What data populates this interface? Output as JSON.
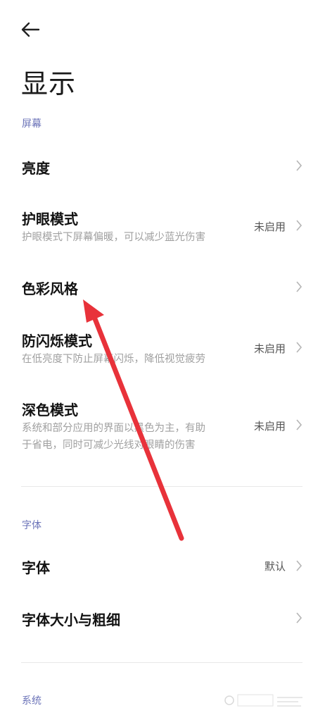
{
  "header": {
    "back_icon": "arrow-left-icon",
    "title": "显示"
  },
  "sections": {
    "screen": {
      "label": "屏幕",
      "items": [
        {
          "title": "亮度",
          "subtitle": "",
          "value": ""
        },
        {
          "title": "护眼模式",
          "subtitle": "护眼模式下屏幕偏暖，可以减少蓝光伤害",
          "value": "未启用"
        },
        {
          "title": "色彩风格",
          "subtitle": "",
          "value": ""
        },
        {
          "title": "防闪烁模式",
          "subtitle": "在低亮度下防止屏幕闪烁，降低视觉疲劳",
          "value": "未启用"
        },
        {
          "title": "深色模式",
          "subtitle_line1": "系统和部分应用的界面以黑色为主，有助",
          "subtitle_line2": "于省电，同时可减少光线对眼睛的伤害",
          "value": "未启用"
        }
      ]
    },
    "font": {
      "label": "字体",
      "items": [
        {
          "title": "字体",
          "value": "默认"
        },
        {
          "title": "字体大小与粗细",
          "value": ""
        }
      ]
    },
    "system": {
      "label": "系统"
    }
  },
  "annotation": {
    "color": "#e8323a"
  }
}
